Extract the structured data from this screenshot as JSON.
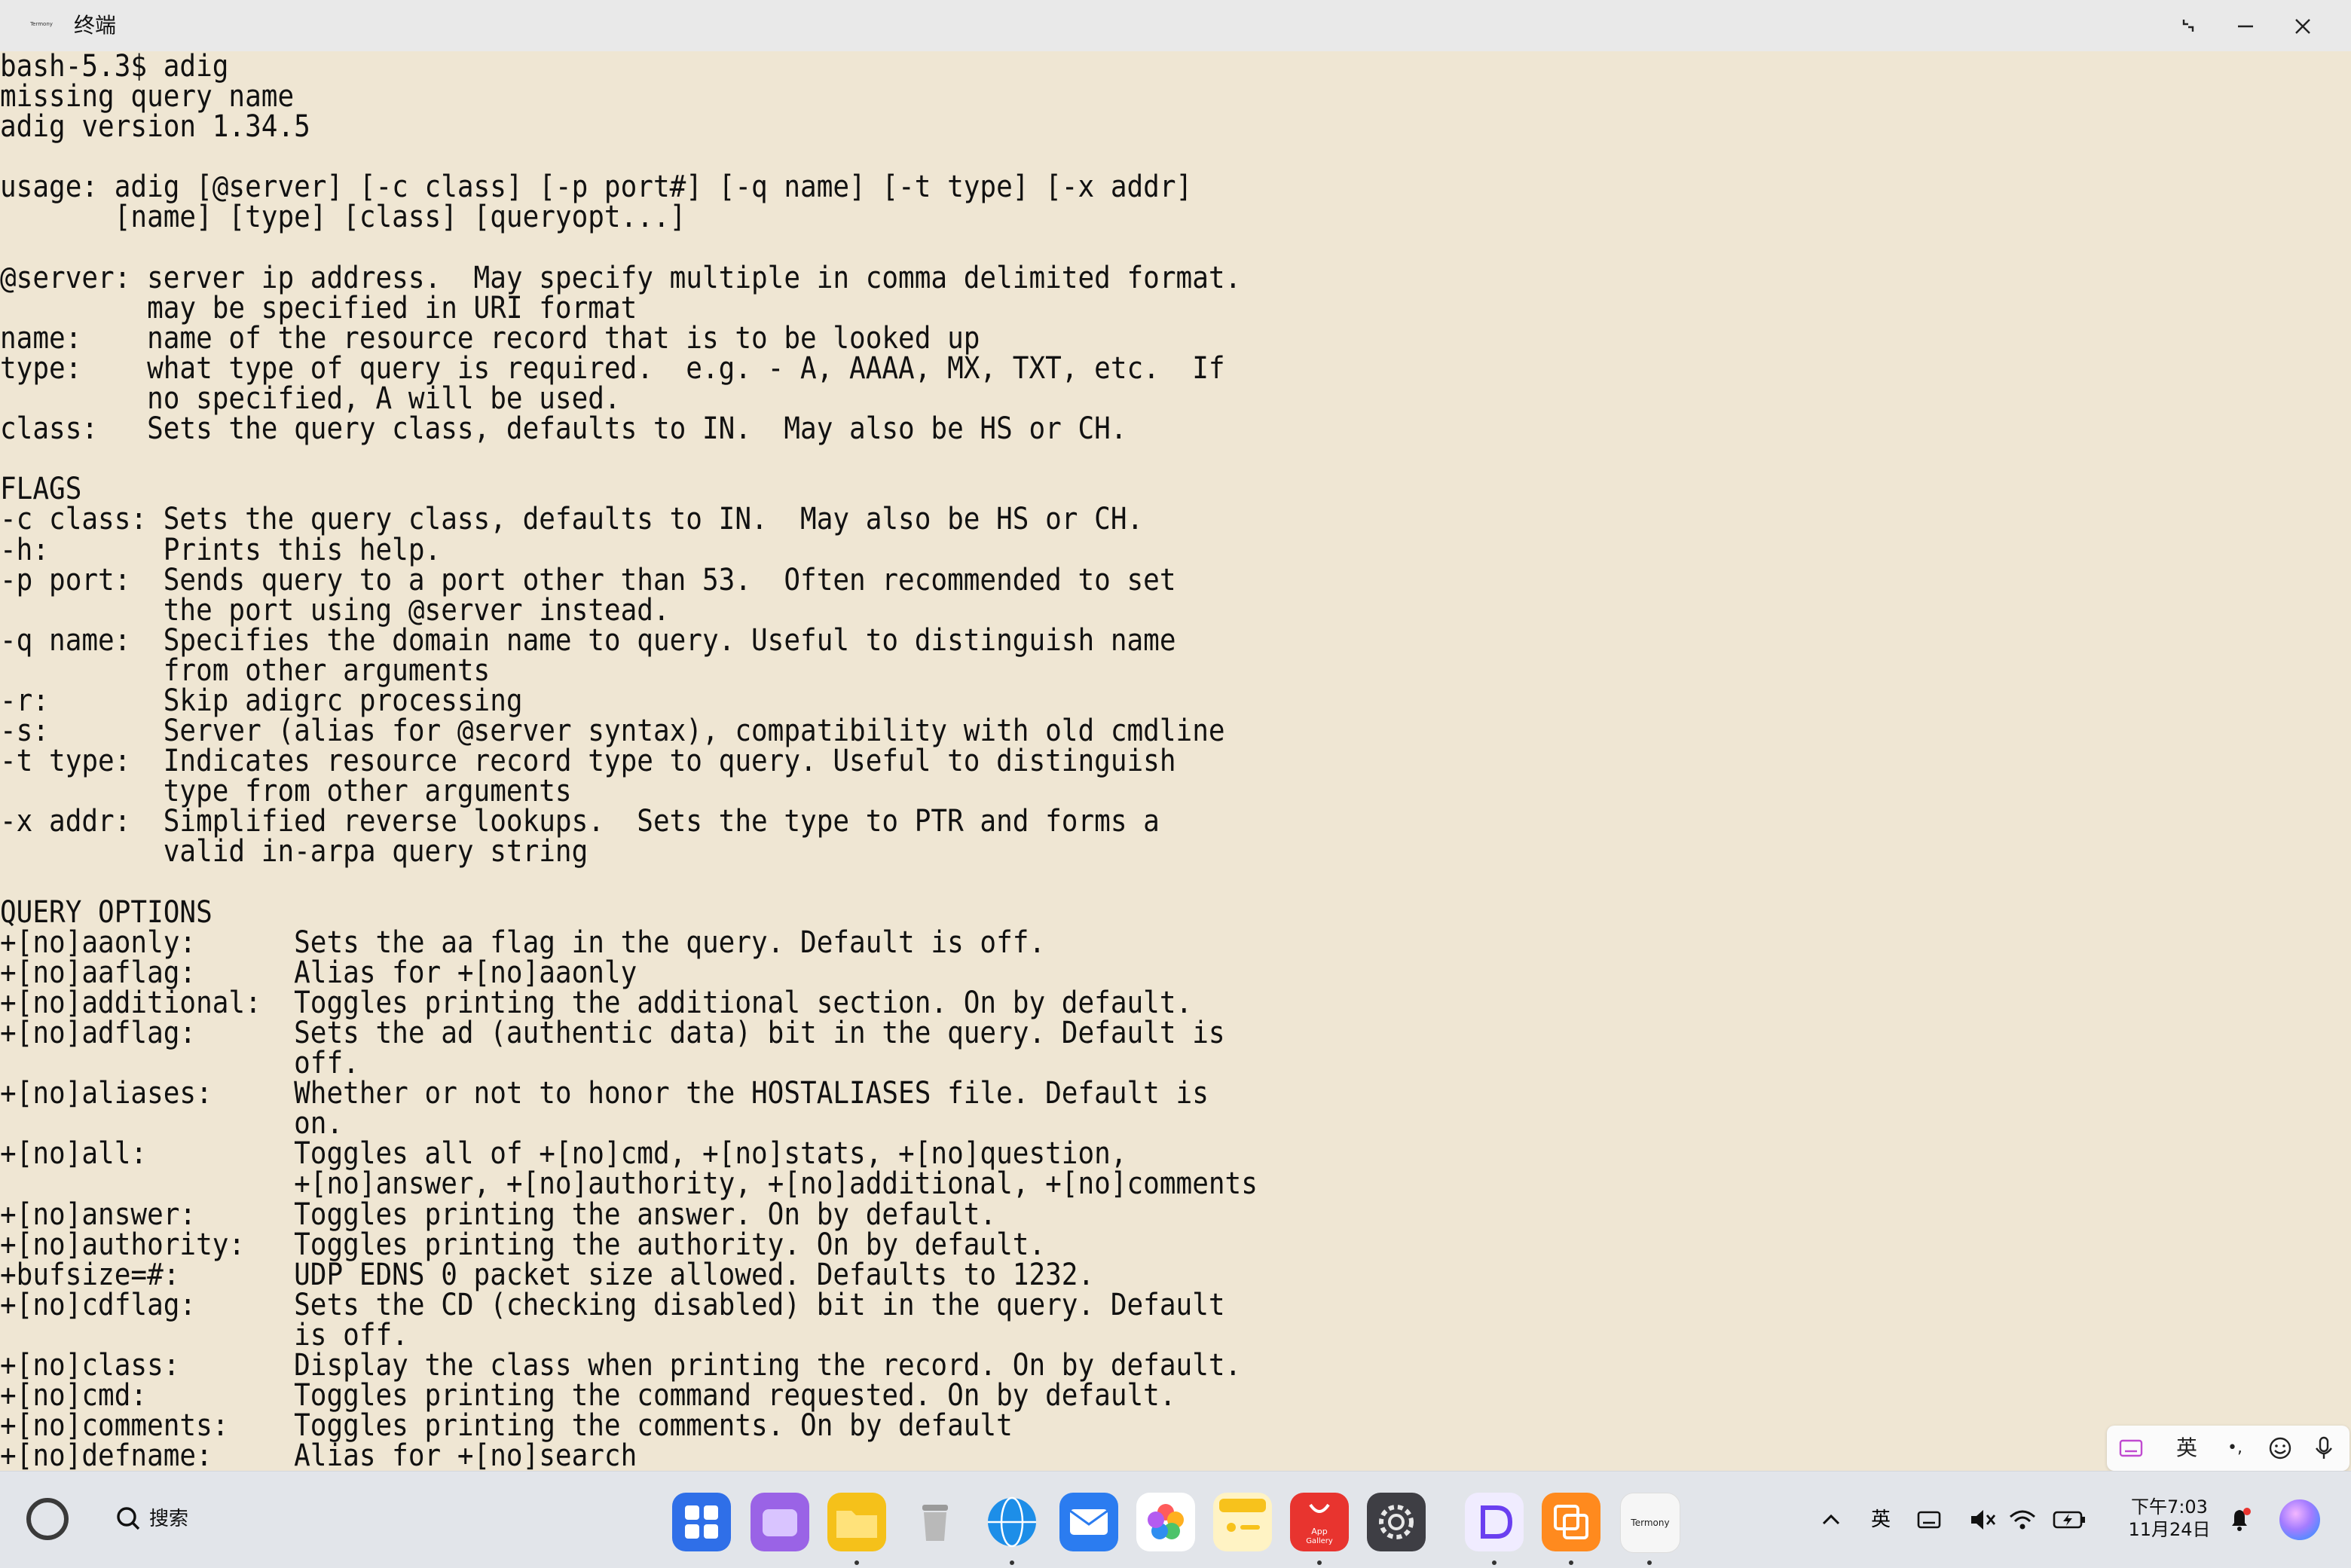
{
  "window": {
    "title": "终端",
    "app_icon_label": "Termony"
  },
  "terminal": {
    "lines": [
      "bash-5.3$ adig",
      "missing query name",
      "adig version 1.34.5",
      "",
      "usage: adig [@server] [-c class] [-p port#] [-q name] [-t type] [-x addr]",
      "       [name] [type] [class] [queryopt...]",
      "",
      "@server: server ip address.  May specify multiple in comma delimited format.",
      "         may be specified in URI format",
      "name:    name of the resource record that is to be looked up",
      "type:    what type of query is required.  e.g. - A, AAAA, MX, TXT, etc.  If",
      "         no specified, A will be used.",
      "class:   Sets the query class, defaults to IN.  May also be HS or CH.",
      "",
      "FLAGS",
      "-c class: Sets the query class, defaults to IN.  May also be HS or CH.",
      "-h:       Prints this help.",
      "-p port:  Sends query to a port other than 53.  Often recommended to set",
      "          the port using @server instead.",
      "-q name:  Specifies the domain name to query. Useful to distinguish name",
      "          from other arguments",
      "-r:       Skip adigrc processing",
      "-s:       Server (alias for @server syntax), compatibility with old cmdline",
      "-t type:  Indicates resource record type to query. Useful to distinguish",
      "          type from other arguments",
      "-x addr:  Simplified reverse lookups.  Sets the type to PTR and forms a",
      "          valid in-arpa query string",
      "",
      "QUERY OPTIONS",
      "+[no]aaonly:      Sets the aa flag in the query. Default is off.",
      "+[no]aaflag:      Alias for +[no]aaonly",
      "+[no]additional:  Toggles printing the additional section. On by default.",
      "+[no]adflag:      Sets the ad (authentic data) bit in the query. Default is",
      "                  off.",
      "+[no]aliases:     Whether or not to honor the HOSTALIASES file. Default is",
      "                  on.",
      "+[no]all:         Toggles all of +[no]cmd, +[no]stats, +[no]question,",
      "                  +[no]answer, +[no]authority, +[no]additional, +[no]comments",
      "+[no]answer:      Toggles printing the answer. On by default.",
      "+[no]authority:   Toggles printing the authority. On by default.",
      "+bufsize=#:       UDP EDNS 0 packet size allowed. Defaults to 1232.",
      "+[no]cdflag:      Sets the CD (checking disabled) bit in the query. Default",
      "                  is off.",
      "+[no]class:       Display the class when printing the record. On by default.",
      "+[no]cmd:         Toggles printing the command requested. On by default.",
      "+[no]comments:    Toggles printing the comments. On by default",
      "+[no]defname:     Alias for +[no]search"
    ]
  },
  "ime": {
    "lang_label": "英",
    "punct_label": "•,"
  },
  "taskbar": {
    "search_label": "搜索",
    "tray_lang": "英",
    "clock_time": "下午7:03",
    "clock_date": "11月24日",
    "dock_apps": [
      {
        "name": "Launcher",
        "running": false
      },
      {
        "name": "Notes",
        "running": false
      },
      {
        "name": "Files",
        "running": true
      },
      {
        "name": "Recycle Bin",
        "running": false
      },
      {
        "name": "Browser",
        "running": true
      },
      {
        "name": "Email",
        "running": false
      },
      {
        "name": "Gallery",
        "running": false
      },
      {
        "name": "Memo",
        "running": false
      },
      {
        "name": "App Gallery",
        "label": "App Gallery",
        "running": true
      },
      {
        "name": "Settings",
        "running": false
      },
      {
        "name": "Editor",
        "running": true
      },
      {
        "name": "Multi Window",
        "running": true
      },
      {
        "name": "Termony",
        "label": "Termony",
        "running": true
      }
    ]
  },
  "colors": {
    "terminal_bg": "#efe6d3",
    "terminal_fg": "#111111",
    "titlebar_bg": "#e9e9e9",
    "taskbar_bg": "#e2e5ea"
  }
}
